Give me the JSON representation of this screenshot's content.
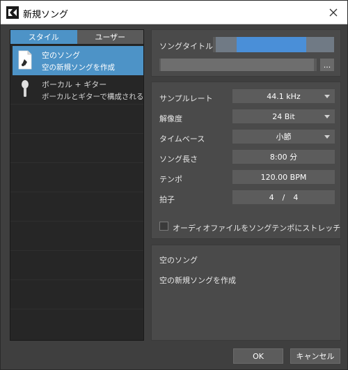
{
  "window": {
    "title": "新規ソング"
  },
  "tabs": [
    {
      "label": "スタイル",
      "active": true
    },
    {
      "label": "ユーザー",
      "active": false
    }
  ],
  "styles": [
    {
      "title": "空のソング",
      "subtitle": "空の新規ソングを作成",
      "icon": "document-note-icon",
      "selected": true
    },
    {
      "title": "ボーカル + ギター",
      "subtitle": "ボーカルとギターで構成されるソング",
      "icon": "microphone-icon",
      "selected": false
    }
  ],
  "song": {
    "title_label": "ソングタイトル",
    "browse_label": "..."
  },
  "settings": {
    "sample_rate": {
      "label": "サンプルレート",
      "value": "44.1 kHz"
    },
    "bit_depth": {
      "label": "解像度",
      "value": "24 Bit"
    },
    "timebase": {
      "label": "タイムベース",
      "value": "小節"
    },
    "length": {
      "label": "ソング長さ",
      "value": "8:00 分"
    },
    "tempo": {
      "label": "テンポ",
      "value": "120.00 BPM"
    },
    "time_signature": {
      "label": "拍子",
      "numerator": "4",
      "separator": "/",
      "denominator": "4"
    },
    "stretch_label": "オーディオファイルをソングテンポにストレッチ"
  },
  "description": {
    "title": "空のソング",
    "text": "空の新規ソングを作成"
  },
  "buttons": {
    "ok": "OK",
    "cancel": "キャンセル"
  },
  "colors": {
    "accent": "#4d93c7",
    "panel": "#4a4a4a",
    "field": "#5c5c5c"
  }
}
